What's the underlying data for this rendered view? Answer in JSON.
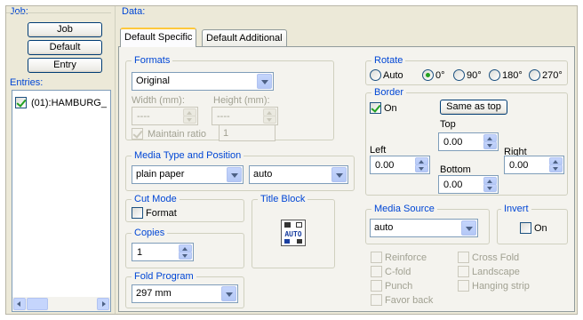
{
  "job": {
    "group_label": "Job:",
    "buttons": [
      "Job",
      "Default",
      "Entry"
    ]
  },
  "entries": {
    "group_label": "Entries:",
    "items": [
      {
        "label": "(01):HAMBURG_",
        "checked": true
      }
    ]
  },
  "data": {
    "group_label": "Data:",
    "tabs": [
      "Default Specific",
      "Default Additional"
    ],
    "active_tab": "Default Specific"
  },
  "formats": {
    "label": "Formats",
    "selected": "Original",
    "width_label": "Width (mm):",
    "height_label": "Height (mm):",
    "width_value": "----",
    "height_value": "----",
    "maintain_ratio_label": "Maintain ratio",
    "ratio_value": "1"
  },
  "media_type": {
    "label": "Media Type and Position",
    "type_selected": "plain paper",
    "position_selected": "auto"
  },
  "cut_mode": {
    "label": "Cut Mode",
    "format_label": "Format",
    "format_checked": false
  },
  "copies": {
    "label": "Copies",
    "value": "1"
  },
  "title_block": {
    "label": "Title Block",
    "icon_text": "AUTO"
  },
  "fold_program": {
    "label": "Fold Program",
    "selected": "297 mm"
  },
  "rotate": {
    "label": "Rotate",
    "options": [
      "Auto",
      "0°",
      "90°",
      "180°",
      "270°"
    ],
    "selected": "0°"
  },
  "border": {
    "label": "Border",
    "on_label": "On",
    "on_checked": true,
    "same_as_top_label": "Same as top",
    "top_label": "Top",
    "top_value": "0.00",
    "left_label": "Left",
    "left_value": "0.00",
    "right_label": "Right",
    "right_value": "0.00",
    "bottom_label": "Bottom",
    "bottom_value": "0.00"
  },
  "media_source": {
    "label": "Media Source",
    "selected": "auto"
  },
  "invert": {
    "label": "Invert",
    "on_label": "On",
    "checked": false
  },
  "finishing": {
    "left": [
      "Reinforce",
      "C-fold",
      "Punch",
      "Favor back"
    ],
    "right": [
      "Cross Fold",
      "Landscape",
      "Hanging strip"
    ]
  },
  "colors": {
    "group_label": "#0046d5",
    "selected_tab_accent": "#ffc83c",
    "checkmark": "#21a121"
  }
}
